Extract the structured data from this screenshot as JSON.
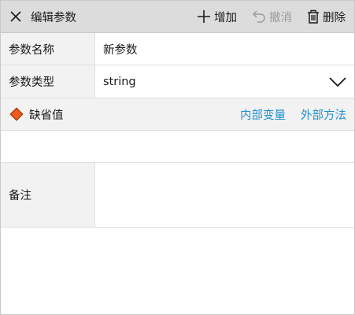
{
  "header": {
    "title": "编辑参数",
    "add_label": "增加",
    "undo_label": "撤消",
    "delete_label": "删除"
  },
  "form": {
    "name_label": "参数名称",
    "name_value": "新参数",
    "type_label": "参数类型",
    "type_value": "string",
    "default_label": "缺省值",
    "internal_var_link": "内部变量",
    "external_method_link": "外部方法",
    "default_value": "",
    "remark_label": "备注",
    "remark_value": ""
  },
  "colors": {
    "header_bg": "#dcdcdc",
    "label_bg": "#f2f2f2",
    "link": "#1f8fd1",
    "diamond": "#f05a1a",
    "disabled_text": "#9a9a9a"
  },
  "icons": {
    "close": "close-icon",
    "add": "plus-icon",
    "undo": "undo-icon",
    "delete": "trash-icon",
    "dropdown": "chevron-down-icon",
    "default_marker": "diamond-icon"
  }
}
